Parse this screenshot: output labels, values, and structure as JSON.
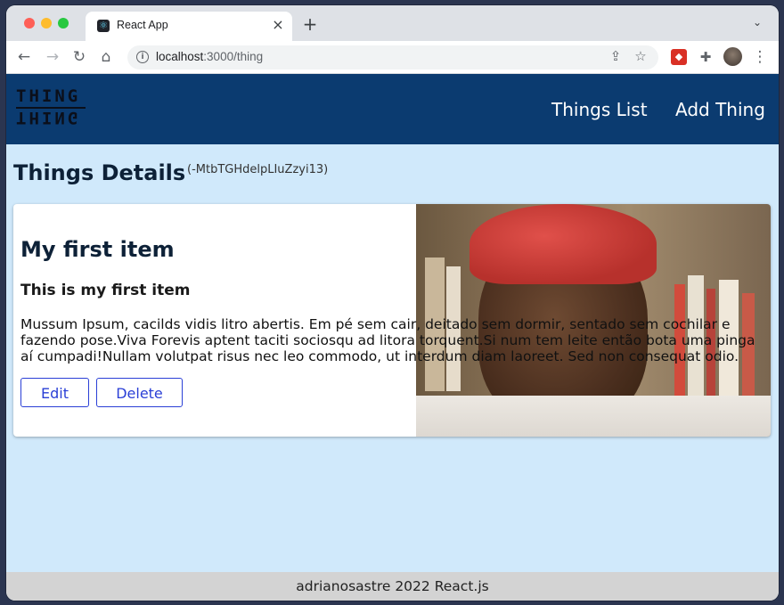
{
  "browser": {
    "tab_title": "React App",
    "tab_close_icon": "×",
    "new_tab_icon": "+",
    "tab_menu_icon": "⌄",
    "url_host": "localhost",
    "url_path": ":3000/thing"
  },
  "app": {
    "logo_text": "THING",
    "logo_text_mirrored": "THING",
    "nav": [
      {
        "label": "Things List"
      },
      {
        "label": "Add Thing"
      }
    ]
  },
  "page": {
    "title": "Things Details",
    "id": "(-MtbTGHdelpLIuZzyi13)"
  },
  "item": {
    "title": "My first item",
    "subtitle": "This is my first item",
    "description": "Mussum Ipsum, cacilds vidis litro abertis. Em pé sem cair, deitado sem dormir, sentado sem cochilar e fazendo pose.Viva Forevis aptent taciti sociosqu ad litora torquent.Si num tem leite então bota uma pinga aí cumpadi!Nullam volutpat risus nec leo commodo, ut interdum diam laoreet. Sed non consequat odio.",
    "edit_label": "Edit",
    "delete_label": "Delete"
  },
  "footer": {
    "text": "adrianosastre 2022 React.js"
  },
  "colors": {
    "header_bg": "#0b3b70",
    "page_bg": "#d0e9fb",
    "button_accent": "#2a3fd6",
    "footer_bg": "#d3d3d3"
  }
}
